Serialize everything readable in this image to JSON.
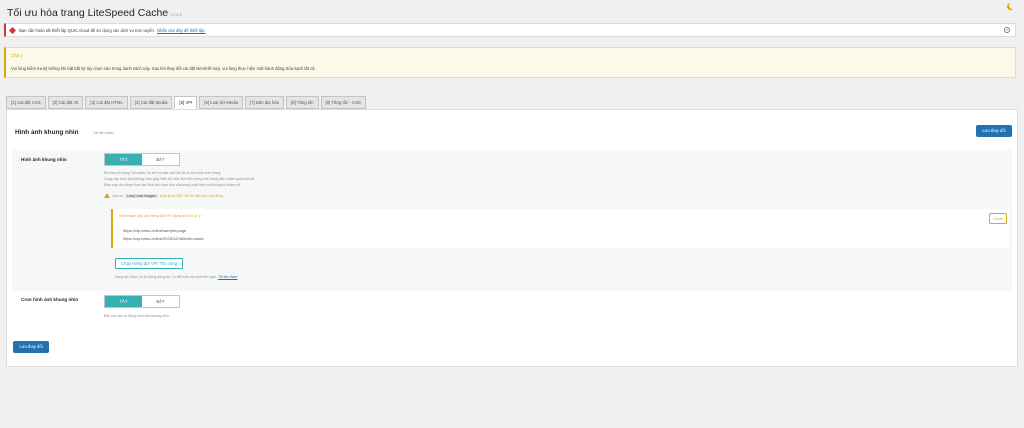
{
  "header": {
    "title": "Tối ưu hóa trang LiteSpeed Cache",
    "version": "v7.6.2"
  },
  "notice_error": {
    "text": "Bạn cần hoàn tất thiết lập QUIC.cloud để sử dụng các dịch vụ trực tuyến.",
    "link": "Nhấn vào đây để thiết lập."
  },
  "notice_warn": {
    "heading": "Chú ý",
    "body": "Vui lòng kiểm tra kỹ lưỡng khi bật bất kỳ tùy chọn nào trong danh sách này. Sau khi thay đổi cài đặt Nén/Kết hợp, vui lòng thực hiện một hành động Xóa sạch tất cả."
  },
  "tabs": [
    "[1] Cài đặt CSS",
    "[2] Cài đặt JS",
    "[3] Cài đặt HTML",
    "[4] Cài đặt Media",
    "[5] VPI",
    "[6] Loại trừ Media",
    "[7] Bản địa hóa",
    "[8] Tăng tốc",
    "[9] Tăng tốc - CSS"
  ],
  "section": {
    "title": "Hình ảnh khung nhìn",
    "subtitle": "Tài liệu tham",
    "save_label": "Lưu thay đổi"
  },
  "vpi": {
    "label": "Hình ảnh khung nhìn",
    "off": "TẮT",
    "on": "BẬT",
    "desc1": "Khi bạn sử dụng Tải chậm, nó sẽ trì hoãn việc tải tất cả hình ảnh trên trang.",
    "desc2": "Cung cấp hình ảnh khung nhìn giúp hiển thị hình ảnh trên trang mà không làm chậm quá trình tải.",
    "desc3": "Điều này cho phép thao tác hình ảnh ban đầu của trang xuất hiện mà không bị chậm trễ.",
    "note_prefix": "Cần có",
    "note_code": "Lazy Load Images",
    "note_suffix": "phải được BẬT để cài đặt này hoạt động.",
    "queue_title": "Danh sách yêu cầu hàng đợi VPI hàng chờ xử lý: 2",
    "urls": [
      "https://vip.bebu.online/sample-page",
      "https://vip.bebu.online/2025/12/08/hello-world"
    ],
    "clear": "Clear",
    "cron_button": "Chạy Hàng đợi VPI Thủ công",
    "cron_note": "Hàng đợi được xử lý không đồng bộ. Có thể mất một chút thời gian.",
    "cron_link": "Tài liệu tham"
  },
  "cron": {
    "label": "Cron hình ảnh khung nhìn",
    "off": "TẮT",
    "on": "BẬT",
    "desc": "Bật cron tạo tự động hình ảnh khung nhìn."
  }
}
